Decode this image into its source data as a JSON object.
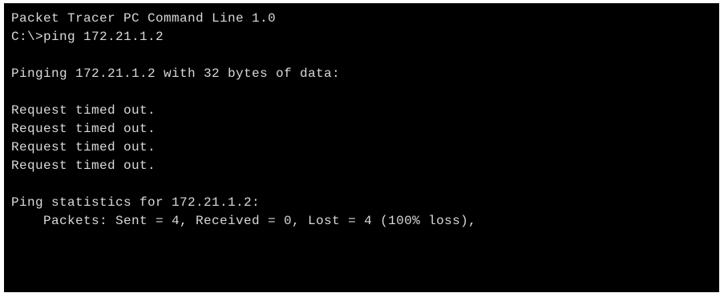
{
  "console": {
    "lines": [
      "Packet Tracer PC Command Line 1.0",
      "C:\\>ping 172.21.1.2",
      "",
      "Pinging 172.21.1.2 with 32 bytes of data:",
      "",
      "Request timed out.",
      "Request timed out.",
      "Request timed out.",
      "Request timed out.",
      "",
      "Ping statistics for 172.21.1.2:",
      "    Packets: Sent = 4, Received = 0, Lost = 4 (100% loss),"
    ],
    "colors": {
      "background": "#000000",
      "text": "#d9d9d9"
    }
  }
}
